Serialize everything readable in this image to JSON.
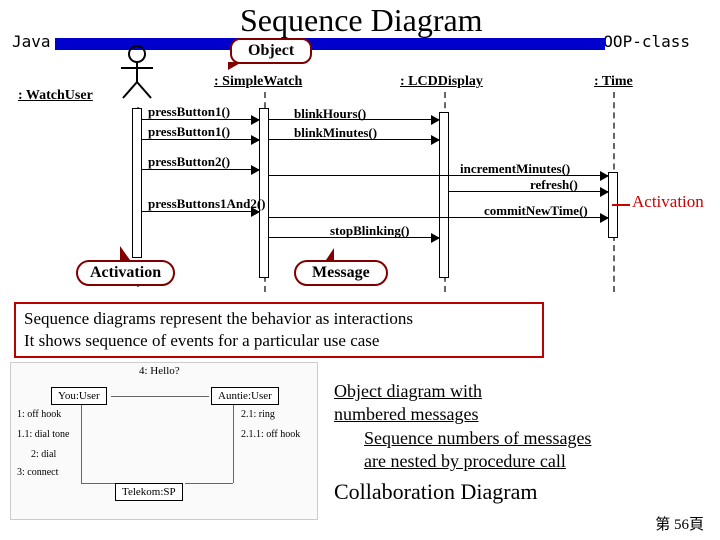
{
  "labels": {
    "java": "Java",
    "oop": "OOP-class",
    "title": "Sequence Diagram",
    "object": "Object",
    "activation": "Activation",
    "message": "Message"
  },
  "lifelines": {
    "watchuser": ": WatchUser",
    "simplewatch": ": SimpleWatch",
    "lcddisplay": ": LCDDisplay",
    "time": ": Time"
  },
  "messages": {
    "pressButton1a": "pressButton1()",
    "pressButton1b": "pressButton1()",
    "blinkHours": "blinkHours()",
    "blinkMinutes": "blinkMinutes()",
    "pressButton2": "pressButton2()",
    "incrementMinutes": "incrementMinutes()",
    "refresh": "refresh()",
    "pressButtons12": "pressButtons1And2()",
    "commitNewTime": "commitNewTime()",
    "stopBlinking": "stopBlinking()"
  },
  "redbox": {
    "line1": "Sequence diagrams represent the behavior as interactions",
    "line2": "It shows sequence of events for a particular use case"
  },
  "obj_diagram": {
    "hello": "4: Hello?",
    "you": "You:User",
    "auntie": "Auntie:User",
    "telekom": "Telekom:SP",
    "n1": "1: off hook",
    "n11": "1.1: dial tone",
    "n2": "2: dial",
    "n3": "3: connect",
    "n21": "2.1: ring",
    "n211": "2.1.1: off hook"
  },
  "collab": {
    "l1": "Object diagram with",
    "l2": "numbered messages",
    "l3": "Sequence numbers of  messages",
    "l4": "are nested by procedure call",
    "title": "Collaboration Diagram"
  },
  "page": "第 56頁"
}
